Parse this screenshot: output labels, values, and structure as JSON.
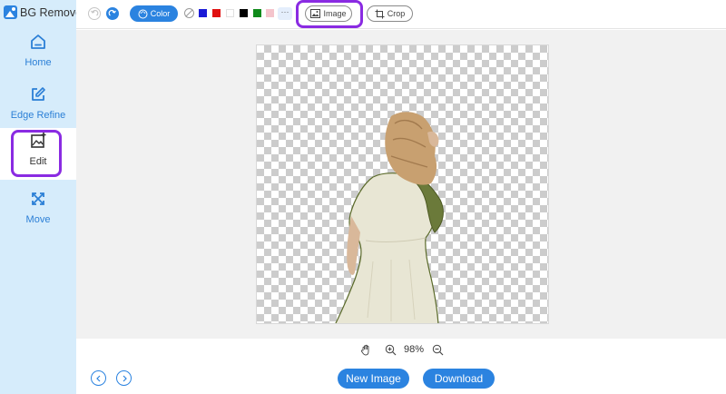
{
  "app": {
    "title": "BG Remover"
  },
  "sidebar": {
    "items": [
      {
        "label": "Home",
        "icon": "home-icon"
      },
      {
        "label": "Edge Refine",
        "icon": "edit-pen-icon"
      },
      {
        "label": "Edit",
        "icon": "image-edit-icon",
        "active": true
      },
      {
        "label": "Move",
        "icon": "move-arrows-icon"
      }
    ]
  },
  "toolbar": {
    "color_label": "Color",
    "image_label": "Image",
    "crop_label": "Crop",
    "more_label": "···",
    "swatches": [
      "#1a1ad6",
      "#e01010",
      "#ffffff",
      "#000000",
      "#0f8a1a",
      "#f4c4cc"
    ]
  },
  "zoom": {
    "value": "98%"
  },
  "footer": {
    "new_image_label": "New Image",
    "download_label": "Download"
  },
  "colors": {
    "accent": "#2b83e0",
    "highlight": "#8a2be2",
    "sidebar_bg": "#d6ecfb"
  }
}
